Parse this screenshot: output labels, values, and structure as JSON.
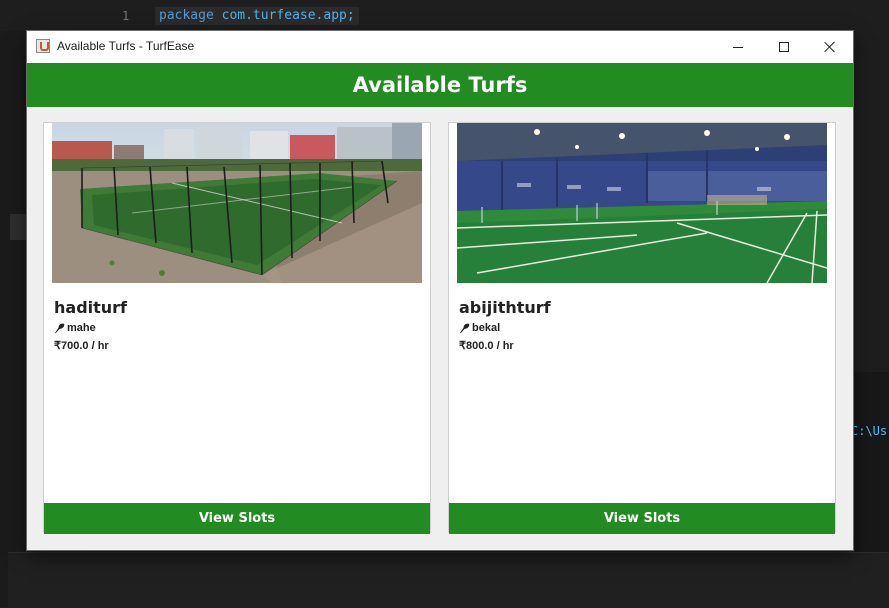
{
  "editor": {
    "line_number": "1",
    "code_keyword": "package",
    "code_rest": " com.turfease.app;",
    "terminal_text": "C:\\Us"
  },
  "window": {
    "title": "Available Turfs - TurfEase",
    "app_icon": "java-cup-icon",
    "controls": [
      "minimize-icon",
      "maximize-icon",
      "close-icon"
    ]
  },
  "header": {
    "title": "Available Turfs",
    "color": "#228b22"
  },
  "turfs": [
    {
      "name": "haditurf",
      "location": "mahe",
      "price": "₹700.0 / hr",
      "button_label": "View Slots",
      "photo": "outdoor-turf-photo"
    },
    {
      "name": "abijithturf",
      "location": "bekal",
      "price": "₹800.0 / hr",
      "button_label": "View Slots",
      "photo": "indoor-court-photo"
    }
  ],
  "colors": {
    "accent": "#228b22",
    "window_bg": "#efefef",
    "card_bg": "#ffffff"
  }
}
